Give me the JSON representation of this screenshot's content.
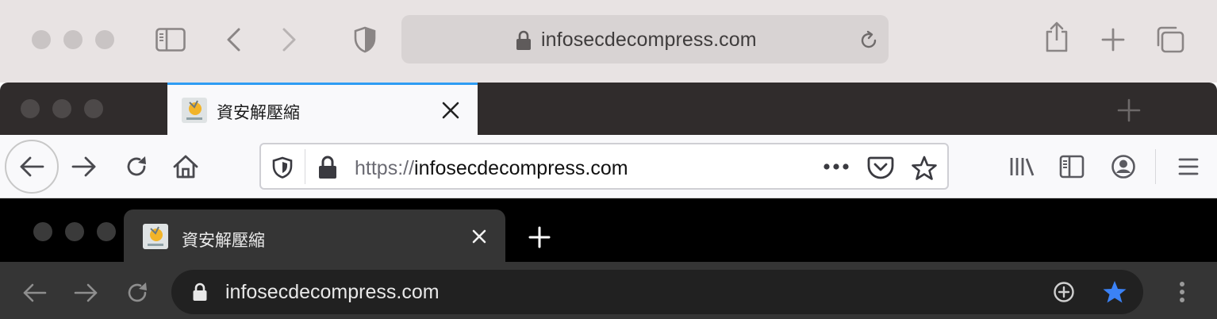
{
  "safari": {
    "url": "infosecdecompress.com",
    "icons": [
      "sidebar-icon",
      "back-icon",
      "forward-icon",
      "shield-icon",
      "lock-icon",
      "reload-icon",
      "share-icon",
      "plus-icon",
      "tabs-icon"
    ]
  },
  "firefox": {
    "tab_title": "資安解壓縮",
    "url_scheme": "https://",
    "url_host": "infosecdecompress.com",
    "icons": [
      "close-icon",
      "new-tab-icon",
      "back-icon",
      "forward-icon",
      "reload-icon",
      "home-icon",
      "shield-icon",
      "lock-icon",
      "more-icon",
      "pocket-icon",
      "bookmark-star-icon",
      "library-icon",
      "sidebar-icon",
      "account-icon",
      "menu-icon"
    ],
    "accent": "#2e9cf3"
  },
  "chrome": {
    "tab_title": "資安解壓縮",
    "url": "infosecdecompress.com",
    "icons": [
      "close-icon",
      "new-tab-icon",
      "back-icon",
      "forward-icon",
      "reload-icon",
      "lock-icon",
      "add-icon",
      "bookmark-star-icon",
      "menu-icon"
    ],
    "accent": "#3b82f6"
  }
}
